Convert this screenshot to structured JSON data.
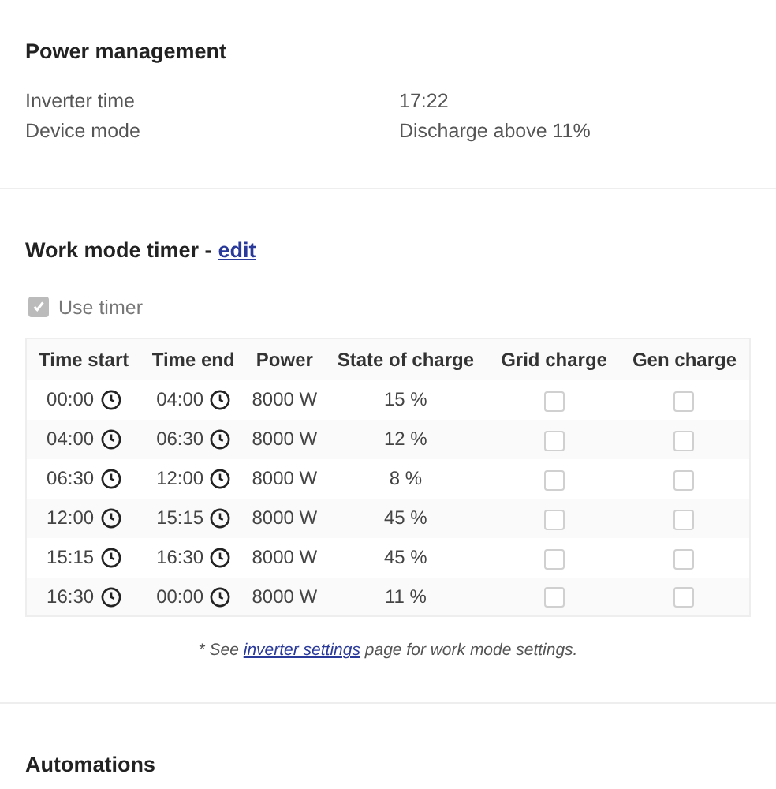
{
  "power_management": {
    "title": "Power management",
    "rows": [
      {
        "label": "Inverter time",
        "value": "17:22"
      },
      {
        "label": "Device mode",
        "value": "Discharge above 11%"
      }
    ]
  },
  "work_mode_timer": {
    "title": "Work mode timer -",
    "edit_link": "edit",
    "use_timer": {
      "label": "Use timer",
      "checked": true,
      "disabled": true
    },
    "table": {
      "columns": [
        "Time start",
        "Time end",
        "Power",
        "State of charge",
        "Grid charge",
        "Gen charge"
      ],
      "rows": [
        {
          "time_start": "00:00",
          "time_end": "04:00",
          "power": "8000 W",
          "state_of_charge": "15 %",
          "grid_charge": false,
          "gen_charge": false
        },
        {
          "time_start": "04:00",
          "time_end": "06:30",
          "power": "8000 W",
          "state_of_charge": "12 %",
          "grid_charge": false,
          "gen_charge": false
        },
        {
          "time_start": "06:30",
          "time_end": "12:00",
          "power": "8000 W",
          "state_of_charge": "8 %",
          "grid_charge": false,
          "gen_charge": false
        },
        {
          "time_start": "12:00",
          "time_end": "15:15",
          "power": "8000 W",
          "state_of_charge": "45 %",
          "grid_charge": false,
          "gen_charge": false
        },
        {
          "time_start": "15:15",
          "time_end": "16:30",
          "power": "8000 W",
          "state_of_charge": "45 %",
          "grid_charge": false,
          "gen_charge": false
        },
        {
          "time_start": "16:30",
          "time_end": "00:00",
          "power": "8000 W",
          "state_of_charge": "11 %",
          "grid_charge": false,
          "gen_charge": false
        }
      ]
    },
    "footnote": {
      "prefix": "* See",
      "link": "inverter settings",
      "suffix": "page for work mode settings."
    }
  },
  "automations": {
    "title": "Automations"
  }
}
